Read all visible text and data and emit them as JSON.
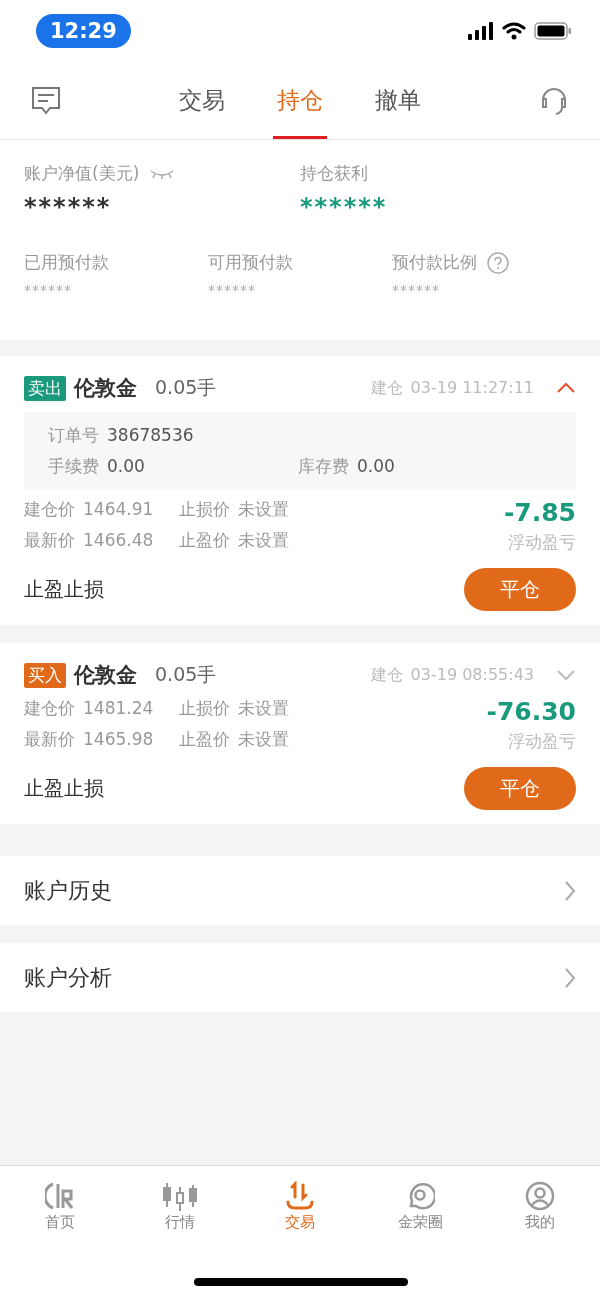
{
  "status_bar": {
    "time": "12:29"
  },
  "header": {
    "tabs": [
      {
        "label": "交易",
        "selected": false
      },
      {
        "label": "持仓",
        "selected": true
      },
      {
        "label": "撤单",
        "selected": false
      }
    ]
  },
  "summary": {
    "top": [
      {
        "label": "账户净值(美元)",
        "value": "******",
        "kind": "equity"
      },
      {
        "label": "持仓获利",
        "value": "******",
        "kind": "profit"
      }
    ],
    "bottom": [
      {
        "label": "已用预付款",
        "value": "******"
      },
      {
        "label": "可用预付款",
        "value": "******"
      },
      {
        "label": "预付款比例",
        "value": "******",
        "help": true
      }
    ]
  },
  "positions": [
    {
      "side": "卖出",
      "color": "#1a9a7c",
      "name": "伦敦金",
      "lots": "0.05手",
      "open_label": "建仓",
      "open_time": "03-19 11:27:11",
      "expanded": true,
      "details": {
        "order_label": "订单号",
        "order": "38678536",
        "fee_label": "手续费",
        "fee": "0.00",
        "swap_label": "库存费",
        "swap": "0.00"
      },
      "rows": [
        {
          "label": "建仓价",
          "value": "1464.91",
          "label2": "止损价",
          "value2": "未设置"
        },
        {
          "label": "最新价",
          "value": "1466.48",
          "label2": "止盈价",
          "value2": "未设置"
        }
      ],
      "pnl": "-7.85",
      "pnl_label": "浮动盈亏",
      "sltp": "止盈止损",
      "close": "平仓"
    },
    {
      "side": "买入",
      "color": "#e06a1a",
      "name": "伦敦金",
      "lots": "0.05手",
      "open_label": "建仓",
      "open_time": "03-19 08:55:43",
      "expanded": false,
      "rows": [
        {
          "label": "建仓价",
          "value": "1481.24",
          "label2": "止损价",
          "value2": "未设置"
        },
        {
          "label": "最新价",
          "value": "1465.98",
          "label2": "止盈价",
          "value2": "未设置"
        }
      ],
      "pnl": "-76.30",
      "pnl_label": "浮动盈亏",
      "sltp": "止盈止损",
      "close": "平仓"
    }
  ],
  "links": [
    "账户历史",
    "账户分析"
  ],
  "tab_bar": [
    {
      "label": "首页",
      "selected": false,
      "kind": "home"
    },
    {
      "label": "行情",
      "selected": false,
      "kind": "market"
    },
    {
      "label": "交易",
      "selected": true,
      "kind": "trade"
    },
    {
      "label": "金荣圈",
      "selected": false,
      "kind": "community"
    },
    {
      "label": "我的",
      "selected": false,
      "kind": "profile"
    }
  ]
}
